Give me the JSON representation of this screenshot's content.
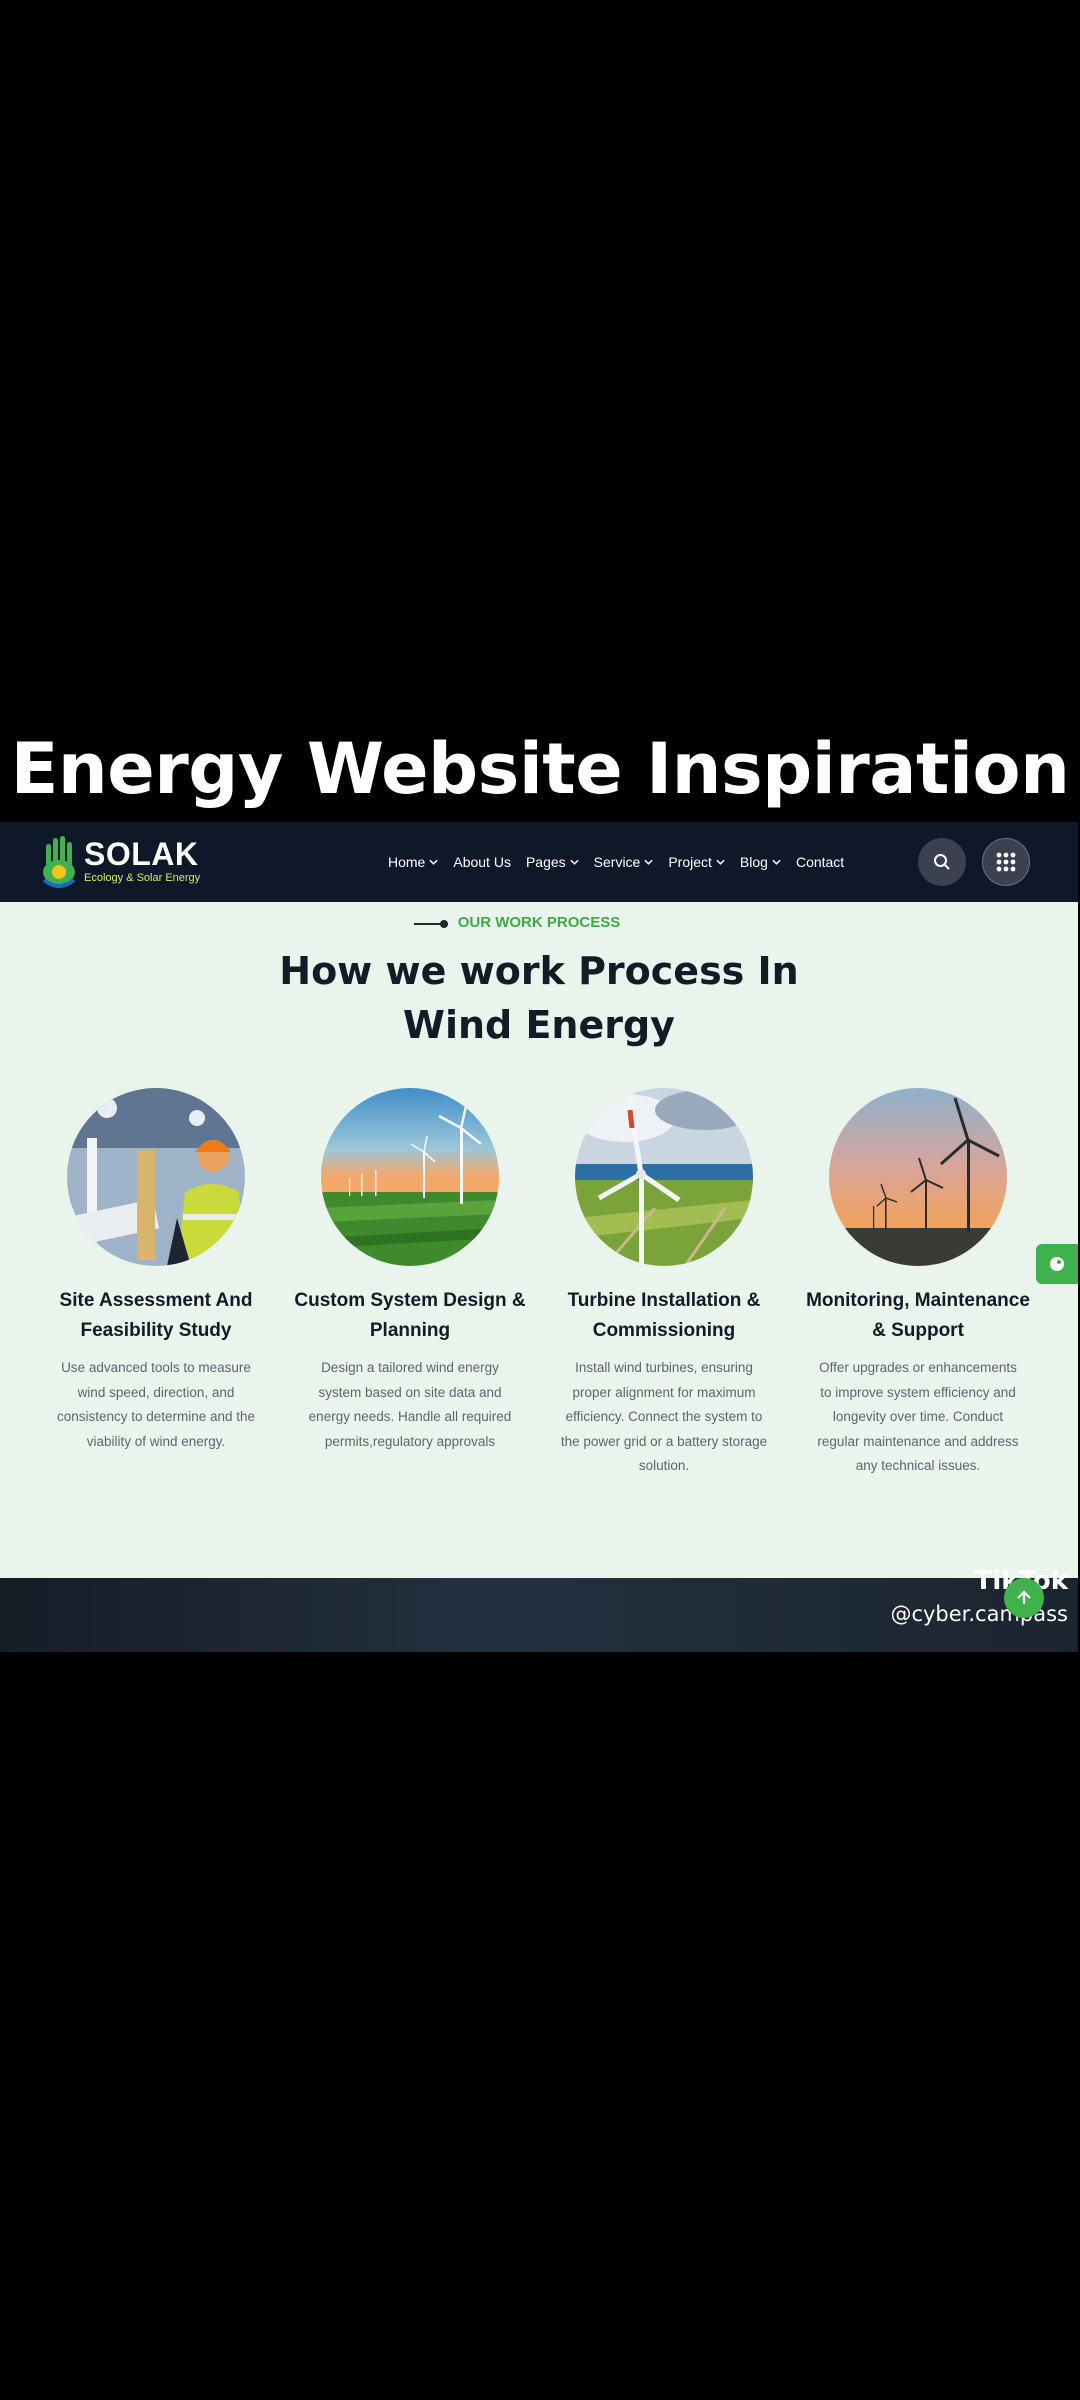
{
  "headline": "Energy Website Inspiration",
  "brand": {
    "name": "SOLAK",
    "tagline": "Ecology & Solar Energy",
    "accent": "#3fb14d"
  },
  "nav": [
    {
      "label": "Home",
      "dropdown": true
    },
    {
      "label": "About Us",
      "dropdown": false
    },
    {
      "label": "Pages",
      "dropdown": true
    },
    {
      "label": "Service",
      "dropdown": true
    },
    {
      "label": "Project",
      "dropdown": true
    },
    {
      "label": "Blog",
      "dropdown": true
    },
    {
      "label": "Contact",
      "dropdown": false
    }
  ],
  "section": {
    "eyebrow": "OUR WORK PROCESS",
    "title_line1": "How we work Process In",
    "title_line2": "Wind Energy"
  },
  "cards": [
    {
      "title_line1": "Site Assessment And",
      "title_line2": "Feasibility Study",
      "desc": [
        "Use advanced tools to measure",
        "wind speed, direction, and",
        "consistency to determine and the",
        "viability of wind energy."
      ]
    },
    {
      "title_line1": "Custom System Design &",
      "title_line2": "Planning",
      "desc": [
        "Design a tailored wind energy",
        "system based on site data and",
        "energy needs. Handle all required",
        "permits,regulatory approvals"
      ]
    },
    {
      "title_line1": "Turbine Installation &",
      "title_line2": "Commissioning",
      "desc": [
        "Install wind turbines, ensuring",
        "proper alignment for maximum",
        "efficiency. Connect the system to",
        "the power grid or a battery storage",
        "solution."
      ]
    },
    {
      "title_line1": "Monitoring, Maintenance",
      "title_line2": "& Support",
      "desc": [
        "Offer upgrades or enhancements",
        "to improve system efficiency and",
        "longevity over time. Conduct",
        "regular maintenance and address",
        "any technical issues."
      ]
    }
  ],
  "watermark": {
    "app": "TikTok",
    "handle": "@cyber.campass"
  }
}
